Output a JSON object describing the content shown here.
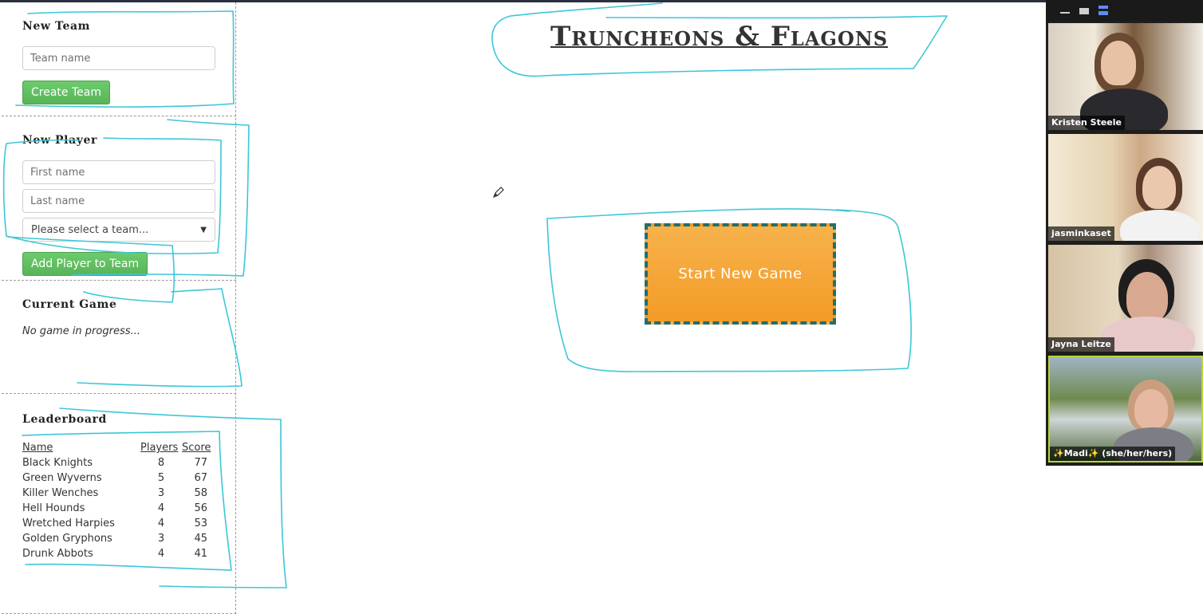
{
  "new_team": {
    "title": "New Team",
    "team_name_placeholder": "Team name",
    "create_button": "Create Team"
  },
  "new_player": {
    "title": "New Player",
    "first_name_placeholder": "First name",
    "last_name_placeholder": "Last name",
    "team_select_value": "Please select a team...",
    "add_button": "Add Player to Team"
  },
  "current_game": {
    "title": "Current Game",
    "status": "No game in progress..."
  },
  "leaderboard": {
    "title": "Leaderboard",
    "headers": {
      "name": "Name",
      "players": "Players",
      "score": "Score"
    },
    "rows": [
      {
        "name": "Black Knights",
        "players": "8",
        "score": "77"
      },
      {
        "name": "Green Wyverns",
        "players": "5",
        "score": "67"
      },
      {
        "name": "Killer Wenches",
        "players": "3",
        "score": "58"
      },
      {
        "name": "Hell Hounds",
        "players": "4",
        "score": "56"
      },
      {
        "name": "Wretched Harpies",
        "players": "4",
        "score": "53"
      },
      {
        "name": "Golden Gryphons",
        "players": "3",
        "score": "45"
      },
      {
        "name": "Drunk Abbots",
        "players": "4",
        "score": "41"
      }
    ]
  },
  "main": {
    "title": "Truncheons & Flagons",
    "start_button": "Start New Game"
  },
  "video_panel": {
    "participants": [
      {
        "name": "Kristen Steele"
      },
      {
        "name": "jasminkaset"
      },
      {
        "name": "Jayna Leitze"
      },
      {
        "name": "✨Madi✨ (she/her/hers)"
      }
    ]
  },
  "colors": {
    "start_button": "#f5a83a",
    "start_button_border": "#1f6f6f",
    "green_button": "#5cb85c",
    "annotation": "#3cc6d8",
    "active_speaker_border": "#b7d63b"
  }
}
